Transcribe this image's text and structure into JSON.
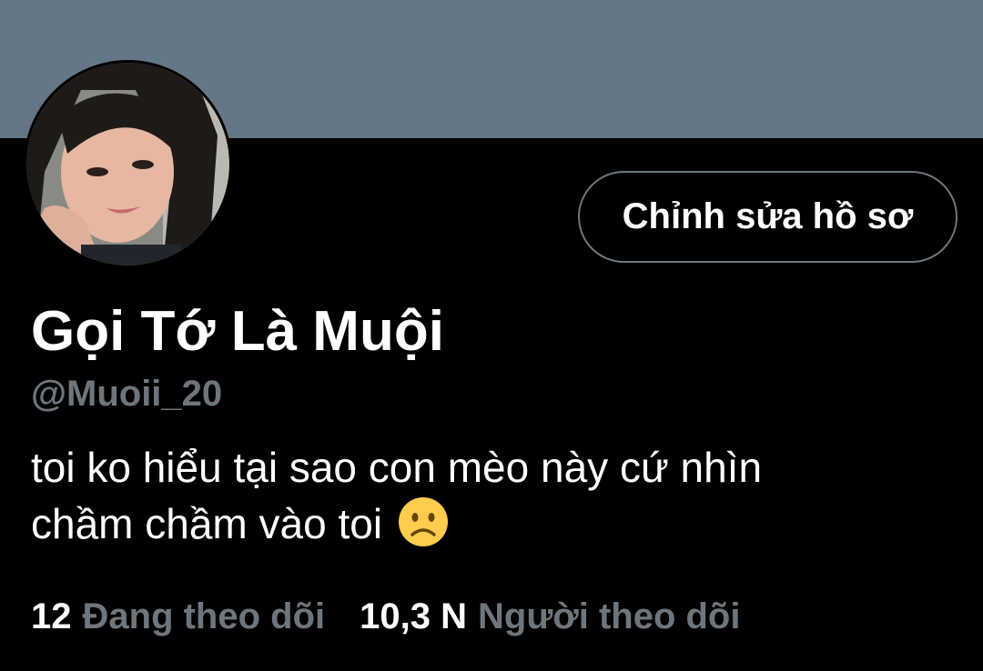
{
  "profile": {
    "banner_color": "#657786",
    "edit_button_label": "Chỉnh sửa hồ sơ",
    "display_name": "Gọi Tớ Là Muội",
    "handle": "@Muoii_20",
    "bio_line1": "toi ko hiểu tại sao con mèo này cứ nhìn",
    "bio_line2": "chầm chầm vào toi",
    "bio_emoji": "frowning-face",
    "following_count": "12",
    "following_label": "Đang theo dõi",
    "followers_count": "10,3 N",
    "followers_label": "Người theo dõi"
  },
  "colors": {
    "background": "#000000",
    "text_primary": "#ffffff",
    "text_secondary": "#6e767d"
  }
}
